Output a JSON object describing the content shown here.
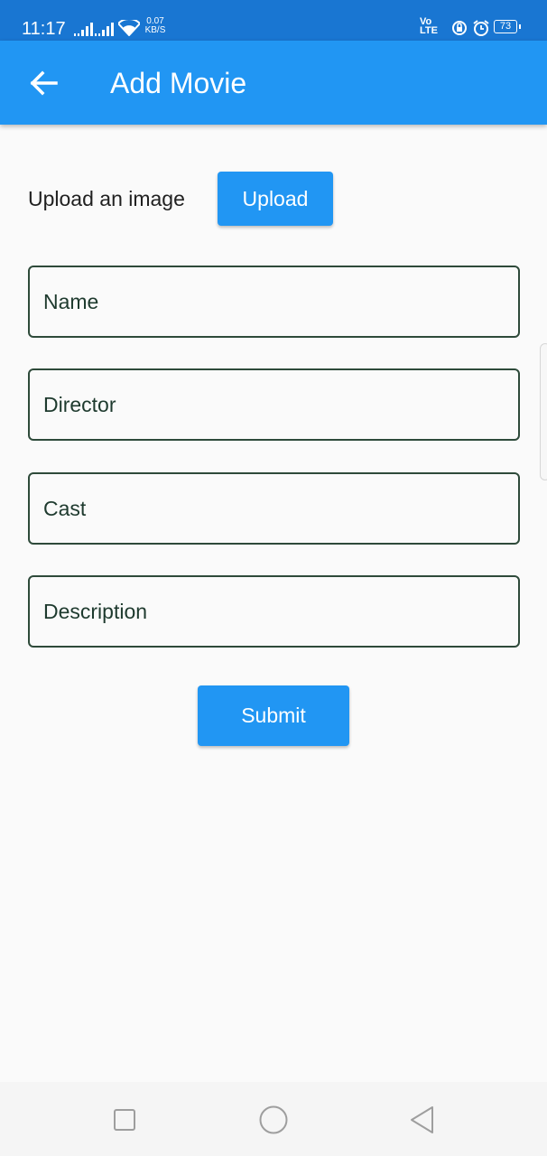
{
  "status_bar": {
    "time": "11:17",
    "net_speed_value": "0.07",
    "net_speed_unit": "KB/S",
    "volte_label": "Vo LTE",
    "battery": "73",
    "icons": [
      "signal-icon",
      "signal-icon",
      "wifi-icon",
      "volte-icon",
      "data-saver-icon",
      "alarm-icon",
      "battery-icon"
    ]
  },
  "app_bar": {
    "title": "Add Movie",
    "back_icon": "arrow-left-icon"
  },
  "form": {
    "upload_label": "Upload an image",
    "upload_button": "Upload",
    "fields": {
      "name": {
        "placeholder": "Name",
        "value": ""
      },
      "director": {
        "placeholder": "Director",
        "value": ""
      },
      "cast": {
        "placeholder": "Cast",
        "value": ""
      },
      "description": {
        "placeholder": "Description",
        "value": ""
      }
    },
    "submit_button": "Submit"
  },
  "nav_bar": {
    "icons": [
      "recents-square-icon",
      "home-circle-icon",
      "back-triangle-icon"
    ]
  },
  "colors": {
    "app_bar": "#2196f3",
    "status_bar": "#1976d2",
    "button": "#2196f3",
    "field_border": "#2e4a3a",
    "background": "#fafafa"
  }
}
